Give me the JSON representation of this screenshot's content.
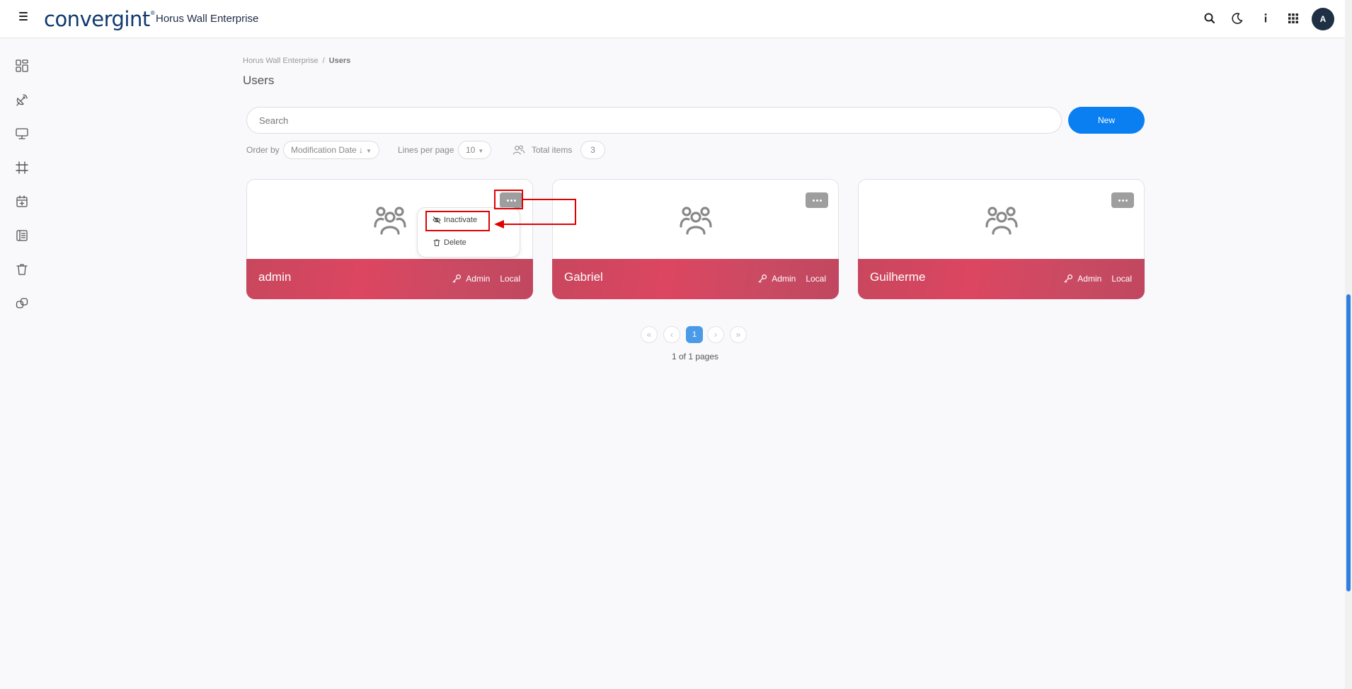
{
  "header": {
    "logo": "convergint",
    "app_title": "Horus Wall Enterprise",
    "avatar": "A",
    "icons": [
      "search-icon",
      "moon-icon",
      "info-icon",
      "apps-grid-icon"
    ]
  },
  "sidebar": {
    "icons": [
      "dashboard-icon",
      "satellite-icon",
      "monitor-icon",
      "frame-icon",
      "calendar-plus-icon",
      "layout-icon",
      "trash-icon",
      "link-icon"
    ]
  },
  "breadcrumb": {
    "parent": "Horus Wall Enterprise",
    "separator": "/",
    "current": "Users"
  },
  "page_title": "Users",
  "search": {
    "placeholder": "Search",
    "value": ""
  },
  "new_button": "New",
  "filters": {
    "order_by_label": "Order by",
    "order_by_value": "Modification Date ↓",
    "lines_label": "Lines per page",
    "lines_value": "10",
    "total_label": "Total items",
    "total_value": "3"
  },
  "cards": [
    {
      "name": "admin",
      "role": "Admin",
      "source": "Local"
    },
    {
      "name": "Gabriel",
      "role": "Admin",
      "source": "Local"
    },
    {
      "name": "Guilherme",
      "role": "Admin",
      "source": "Local"
    }
  ],
  "dropdown": {
    "inactivate": "Inactivate",
    "delete": "Delete"
  },
  "pagination": {
    "first": "«",
    "prev": "‹",
    "current": "1",
    "next": "›",
    "last": "»",
    "info": "1 of 1 pages"
  },
  "colors": {
    "accent": "#0a7ff2",
    "card_footer": "#d8465f",
    "annotation": "#e00000"
  }
}
